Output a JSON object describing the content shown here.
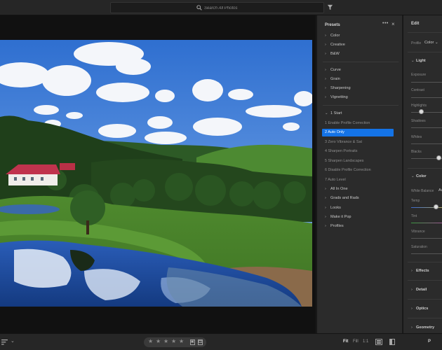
{
  "search": {
    "placeholder": "Search All Photos"
  },
  "presets": {
    "title": "Presets",
    "more": "•••",
    "close": "×",
    "groups_top": [
      "Color",
      "Creative",
      "B&W"
    ],
    "groups_mid": [
      "Curve",
      "Grain",
      "Sharpening",
      "Vignetting"
    ],
    "open_group": "1 Start",
    "items": [
      "1 Enable Profile Correction",
      "2 Auto Only",
      "3 Zero Vibrance & Sat",
      "4 Sharpen Portraits",
      "5 Sharpen Landscapes",
      "6 Disable Profile Correction",
      "7 Auto Level"
    ],
    "selected_index": 1,
    "groups_bottom": [
      "All In One",
      "Grads and Rads",
      "Looks",
      "Make it Pop",
      "Profiles"
    ]
  },
  "edit": {
    "title": "Edit",
    "profile_label": "Profile",
    "profile_value": "Color",
    "light": {
      "title": "Light",
      "exposure": "Exposure",
      "contrast": "Contrast",
      "highlights": "Highlights",
      "shadows": "Shadows",
      "whites": "Whites",
      "blacks": "Blacks"
    },
    "color": {
      "title": "Color",
      "white_balance": "White Balance",
      "white_balance_value": "As",
      "temp": "Temp",
      "tint": "Tint",
      "vibrance": "Vibrance",
      "saturation": "Saturation"
    },
    "sections": [
      "Effects",
      "Detail",
      "Optics",
      "Geometry"
    ]
  },
  "bottombar": {
    "stars": [
      "★",
      "★",
      "★",
      "★",
      "★"
    ],
    "zoom": [
      "Fit",
      "Fill",
      "1:1"
    ],
    "right_label": "P"
  }
}
